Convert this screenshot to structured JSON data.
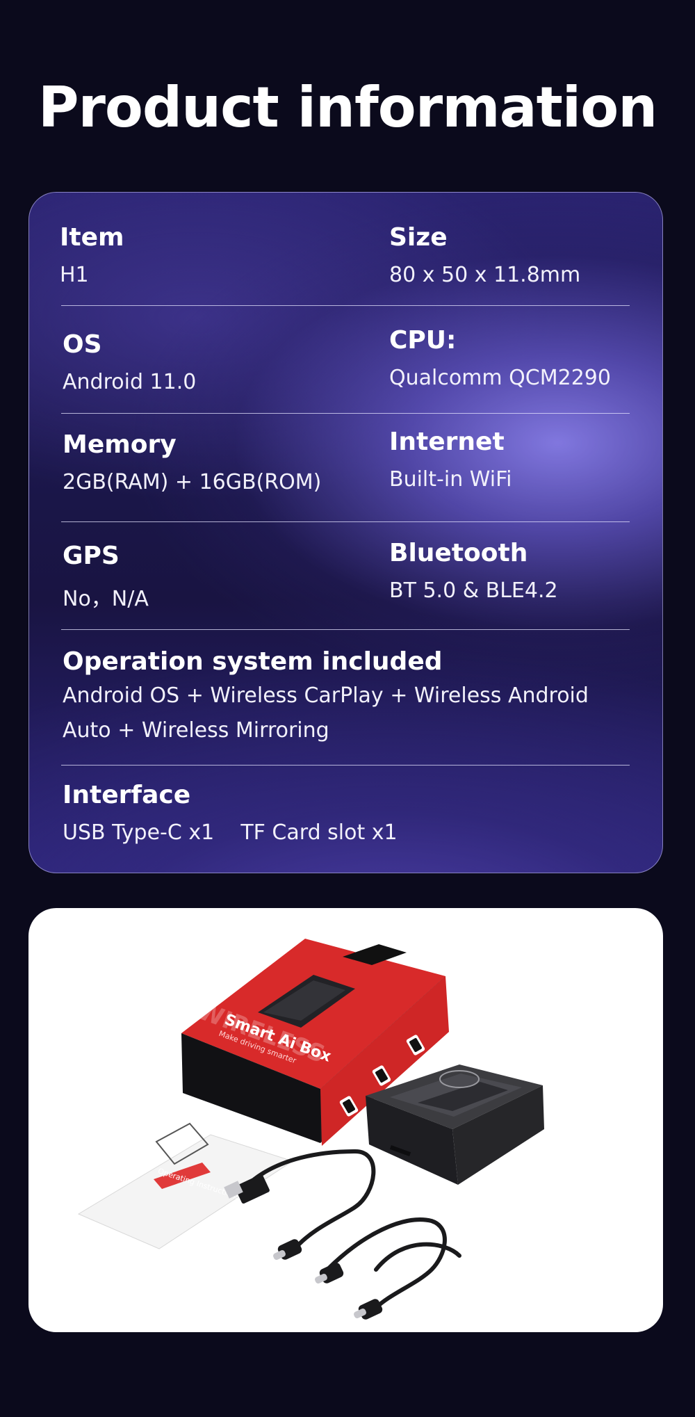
{
  "page": {
    "title": "Product information"
  },
  "specs": {
    "item": {
      "label": "Item",
      "value": "H1"
    },
    "size": {
      "label": "Size",
      "value": "80 x 50 x 11.8mm"
    },
    "os": {
      "label": "OS",
      "value": "Android 11.0"
    },
    "cpu": {
      "label": "CPU:",
      "value": "Qualcomm QCM2290"
    },
    "memory": {
      "label": "Memory",
      "value": "2GB(RAM) + 16GB(ROM)"
    },
    "internet": {
      "label": "Internet",
      "value": "Built-in WiFi"
    },
    "gps": {
      "label": "GPS",
      "value": "No，N/A"
    },
    "bluetooth": {
      "label": "Bluetooth",
      "value": "BT 5.0 & BLE4.2"
    },
    "operation_system": {
      "label": "Operation system included",
      "value": "Android OS + Wireless CarPlay + Wireless Android Auto + Wireless Mirroring"
    },
    "interface": {
      "label": "Interface",
      "value": "USB Type-C x1    TF Card slot x1"
    }
  },
  "product_photo": {
    "box_title": "Smart Ai Box",
    "box_tagline": "Make driving smarter",
    "box_watermark": "WIRELESS",
    "manual_label": "Operating Instructions"
  },
  "colors": {
    "page_bg": "#0b0a1c",
    "card_accent": "#6a5fd0",
    "box_red": "#d92b2b",
    "device_dark": "#2a2a2e"
  }
}
